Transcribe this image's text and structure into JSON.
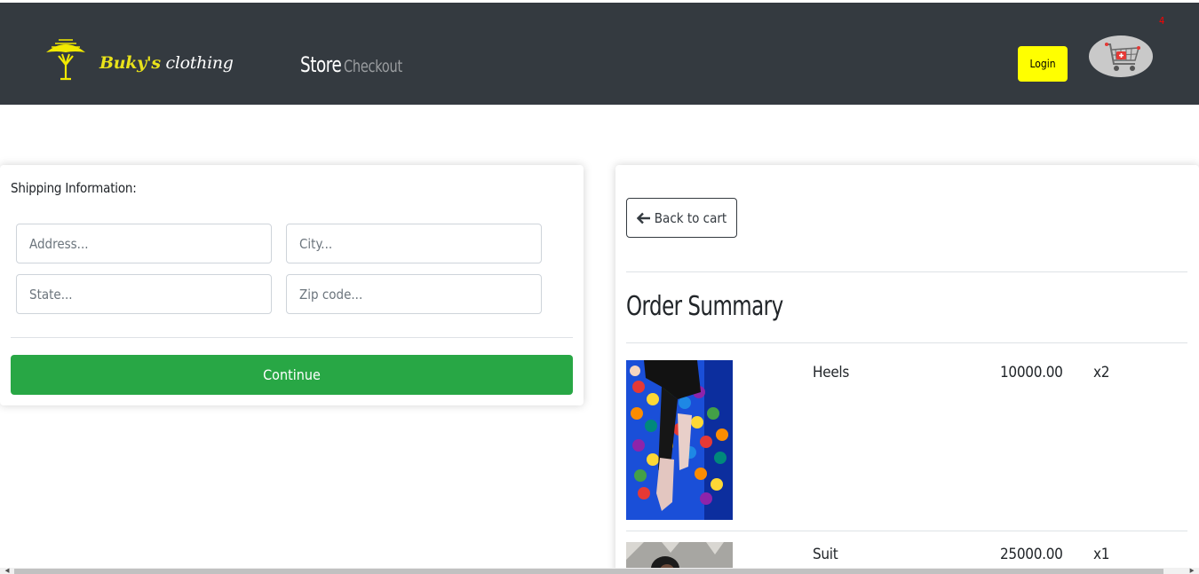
{
  "brand": {
    "name_part1": "Buky's",
    "name_part2": " clothing"
  },
  "nav": {
    "store": "Store",
    "checkout": "Checkout"
  },
  "header": {
    "login_label": "Login",
    "cart_count": "4"
  },
  "shipping": {
    "title": "Shipping Information:",
    "address_placeholder": "Address...",
    "city_placeholder": "City...",
    "state_placeholder": "State...",
    "zip_placeholder": "Zip code...",
    "continue_label": "Continue"
  },
  "summary": {
    "back_label": "Back to cart",
    "title": "Order Summary",
    "items": [
      {
        "name": "Heels",
        "price": "10000.00",
        "qty": "x2"
      },
      {
        "name": "Suit",
        "price": "25000.00",
        "qty": "x1"
      }
    ]
  },
  "colors": {
    "navbar": "#343a40",
    "accent_yellow": "#ffff00",
    "continue_green": "#28a745",
    "cart_badge": "#ff0000"
  }
}
